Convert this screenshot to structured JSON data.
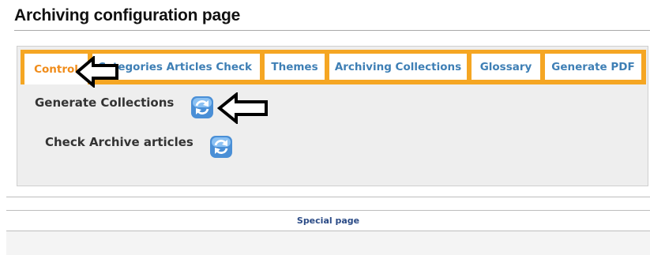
{
  "page": {
    "title": "Archiving configuration page"
  },
  "tabs": [
    {
      "label": "Control",
      "active": true
    },
    {
      "label": "Categories Articles Check",
      "active": false
    },
    {
      "label": "Themes",
      "active": false
    },
    {
      "label": "Archiving Collections",
      "active": false
    },
    {
      "label": "Glossary",
      "active": false
    },
    {
      "label": "Generate PDF",
      "active": false
    }
  ],
  "actions": [
    {
      "label": "Generate Collections",
      "icon": "refresh-icon"
    },
    {
      "label": "Check Archive articles",
      "icon": "refresh-icon"
    }
  ],
  "footer": {
    "link": "Special page"
  },
  "colors": {
    "tab_bar": "#f5a623",
    "active_tab_text": "#f08c1a",
    "tab_text": "#3e7fb5",
    "panel_bg": "#eeeeee",
    "link": "#2b4b86"
  }
}
